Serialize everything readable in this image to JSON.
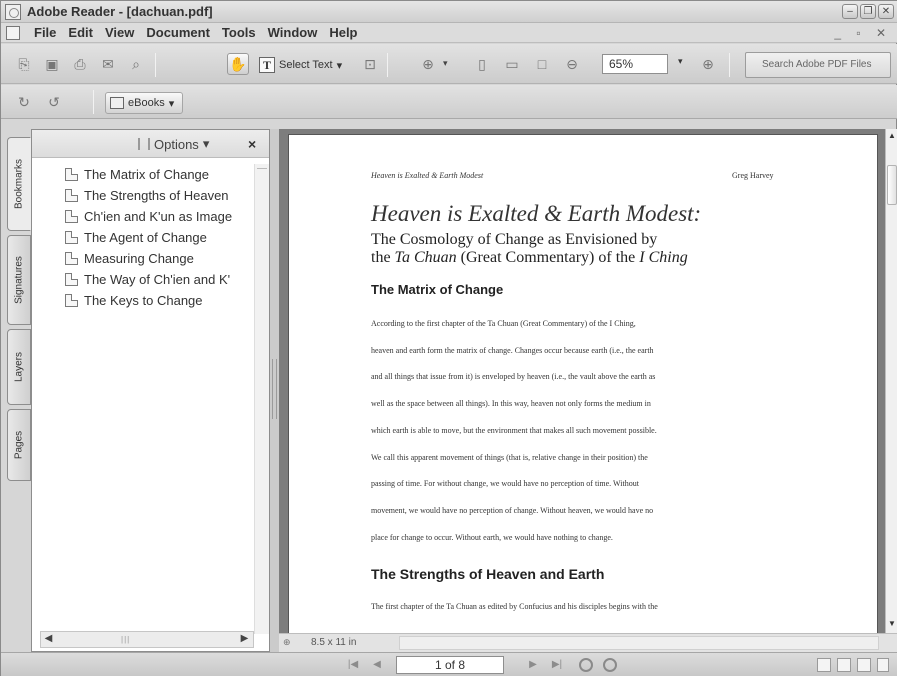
{
  "window": {
    "title": "Adobe Reader - [dachuan.pdf]"
  },
  "menu": {
    "items": [
      "File",
      "Edit",
      "View",
      "Document",
      "Tools",
      "Window",
      "Help"
    ]
  },
  "toolbar": {
    "select_text_label": "Select Text",
    "zoom_value": "65%",
    "search_placeholder": "Search Adobe PDF Files",
    "ebooks_label": "eBooks"
  },
  "side_tabs": [
    "Bookmarks",
    "Signatures",
    "Layers",
    "Pages"
  ],
  "bookmarks_panel": {
    "options_label": "Options",
    "close_glyph": "×",
    "items": [
      "The Matrix of Change",
      "The Strengths of Heaven",
      "Ch'ien and K'un as Image",
      "The Agent of Change",
      "Measuring Change",
      "The Way of Ch'ien and K'",
      "The Keys to Change"
    ]
  },
  "document": {
    "running_head": "Heaven is Exalted & Earth Modest",
    "author": "Greg Harvey",
    "title": "Heaven is Exalted & Earth Modest:",
    "subtitle_line1": "The Cosmology of Change as Envisioned by",
    "subtitle_line2_pre": "the ",
    "subtitle_line2_italic1": "Ta Chuan",
    "subtitle_line2_mid": " (Great Commentary) of the ",
    "subtitle_line2_italic2": "I Ching",
    "section1_heading": "The Matrix of Change",
    "section1_lines": [
      "According to the first chapter of the Ta Chuan (Great Commentary) of the I Ching,",
      "heaven and earth form the matrix of change. Changes occur because earth (i.e., the earth",
      "and all things that issue from it) is enveloped by heaven (i.e., the vault above the earth as",
      "well as the space between all things). In this way, heaven not only forms the medium in",
      "which earth is able to move, but the environment that makes all such movement possible.",
      "We call this apparent movement of things (that is, relative change in their position) the",
      "passing of time. For without change, we would have no perception of time. Without",
      "movement, we would have no perception of change. Without heaven, we would have no",
      "place for change to occur. Without earth, we would have nothing to change."
    ],
    "section2_heading": "The Strengths of Heaven and Earth",
    "section2_lines": [
      "The first chapter of the Ta Chuan as edited by Confucius and his disciples begins with the"
    ]
  },
  "status": {
    "page_size": "8.5 x 11 in",
    "page_indicator": "1 of 8"
  }
}
